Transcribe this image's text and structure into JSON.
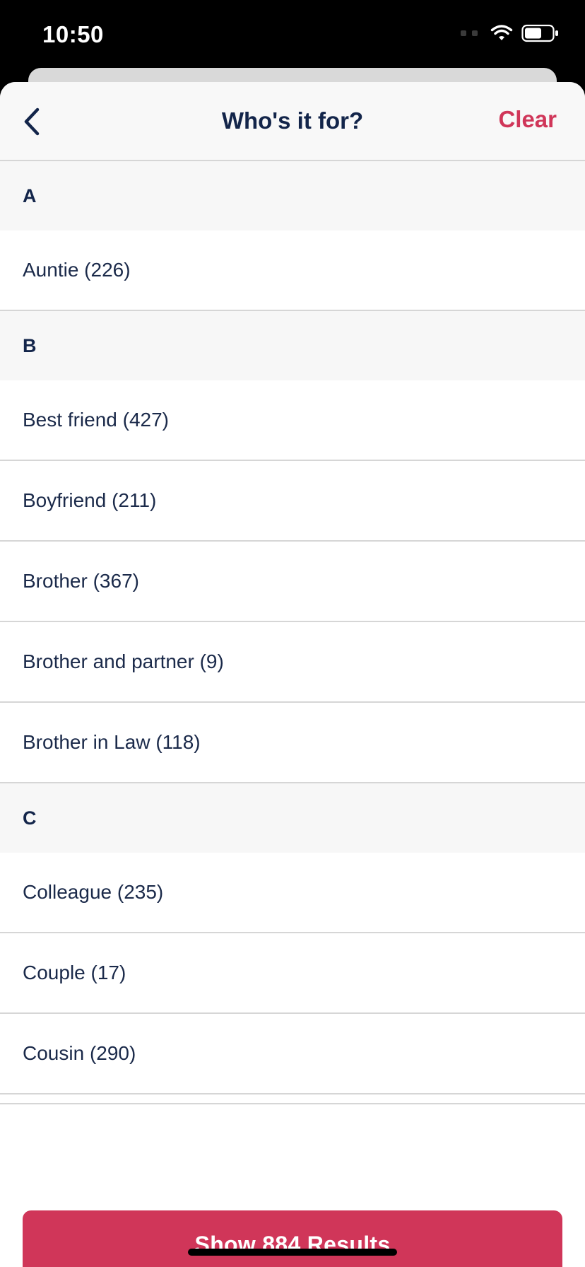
{
  "status_bar": {
    "time": "10:50",
    "icons": [
      "signal-dots-icon",
      "wifi-icon",
      "battery-icon"
    ]
  },
  "header": {
    "back_icon": "chevron-left-icon",
    "title": "Who's it for?",
    "clear_label": "Clear"
  },
  "sections": [
    {
      "letter": "A",
      "items": [
        "Auntie (226)"
      ]
    },
    {
      "letter": "B",
      "items": [
        "Best friend (427)",
        "Boyfriend (211)",
        "Brother (367)",
        "Brother and partner (9)",
        "Brother in Law (118)"
      ]
    },
    {
      "letter": "C",
      "items": [
        "Colleague (235)",
        "Couple (17)",
        "Cousin (290)"
      ]
    }
  ],
  "footer": {
    "button_label": "Show 884 Results"
  },
  "colors": {
    "accent": "#d03659",
    "navy": "#13254a",
    "section_bg": "#f7f7f7"
  }
}
